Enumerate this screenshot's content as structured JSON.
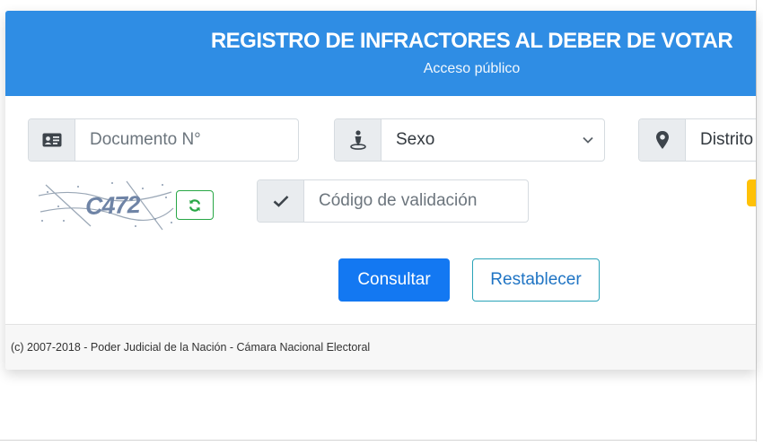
{
  "header": {
    "title": "REGISTRO DE INFRACTORES AL DEBER DE VOTAR",
    "subtitle": "Acceso público"
  },
  "form": {
    "documento": {
      "placeholder": "Documento N°",
      "icon": "id-card-icon"
    },
    "sexo": {
      "value": "Sexo",
      "icon": "person-pin-icon"
    },
    "distrito": {
      "value": "Distrito",
      "icon": "map-marker-icon"
    },
    "captcha": {
      "text": "C472",
      "refresh_icon": "refresh-icon"
    },
    "codigo": {
      "placeholder": "Código de validación",
      "icon": "check-icon"
    }
  },
  "buttons": {
    "consultar": "Consultar",
    "restablecer": "Restablecer"
  },
  "footer": {
    "text": "(c) 2007-2018 - Poder Judicial de la Nación - Cámara Nacional Electoral"
  },
  "colors": {
    "header_bg": "#2f8de4",
    "primary": "#1378f2",
    "outline_border": "#2aa3b8",
    "refresh": "#28a745",
    "warning": "#ffc107"
  }
}
